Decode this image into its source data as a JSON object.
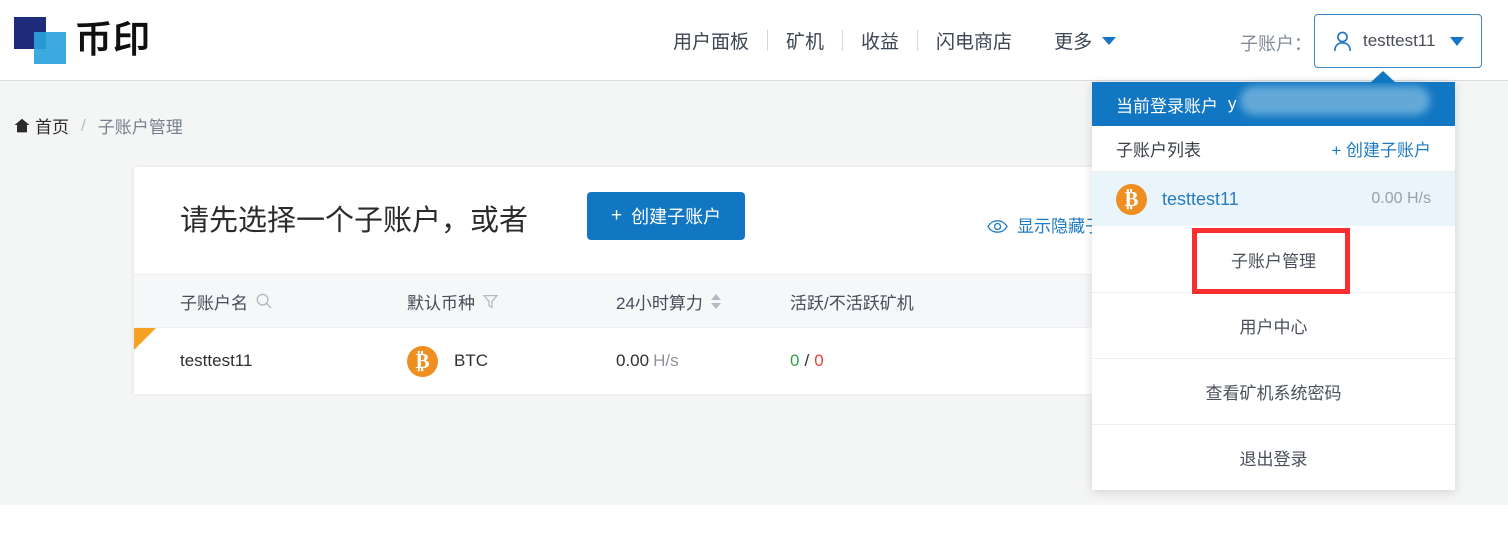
{
  "brand": {
    "name": "币印",
    "logo_dark": "#1f2b7b",
    "logo_light": "#29a3dc"
  },
  "nav": {
    "items": [
      {
        "label": "用户面板"
      },
      {
        "label": "矿机"
      },
      {
        "label": "收益"
      },
      {
        "label": "闪电商店"
      }
    ],
    "more_label": "更多"
  },
  "account": {
    "prefix_label": "子账户：",
    "selected": "testtest11"
  },
  "breadcrumb": {
    "home": "首页",
    "separator": "/",
    "current": "子账户管理"
  },
  "card": {
    "title": "请先选择一个子账户，或者",
    "create_button": "创建子账户",
    "create_plus": "+",
    "show_hidden": "显示隐藏子"
  },
  "table": {
    "columns": [
      {
        "label": "子账户名",
        "icon": "search-icon"
      },
      {
        "label": "默认币种",
        "icon": "filter-icon"
      },
      {
        "label": "24小时算力",
        "icon": "sort-icon"
      },
      {
        "label": "活跃/不活跃矿机",
        "icon": ""
      }
    ],
    "rows": [
      {
        "name": "testtest11",
        "coin": "BTC",
        "coin_symbol": "₿",
        "hashrate_value": "0.00",
        "hashrate_unit": "H/s",
        "miners_active": "0",
        "miners_sep": "/",
        "miners_inactive": "0"
      }
    ]
  },
  "dropdown": {
    "header_label": "当前登录账户",
    "header_account": "y",
    "list_title": "子账户列表",
    "create_sub": "+ 创建子账户",
    "accounts": [
      {
        "name": "testtest11",
        "symbol": "₿",
        "hashrate": "0.00 H/s"
      }
    ],
    "menu": [
      {
        "label": "子账户管理",
        "highlighted": true
      },
      {
        "label": "用户中心",
        "highlighted": false
      },
      {
        "label": "查看矿机系统密码",
        "highlighted": false
      },
      {
        "label": "退出登录",
        "highlighted": false
      }
    ]
  },
  "colors": {
    "accent_blue": "#1277c2",
    "link_blue": "#1d7ac4",
    "bitcoin_orange": "#ef8f21",
    "highlight_red": "#f92f2f",
    "active_green": "#31a24c",
    "inactive_red": "#e94436"
  }
}
